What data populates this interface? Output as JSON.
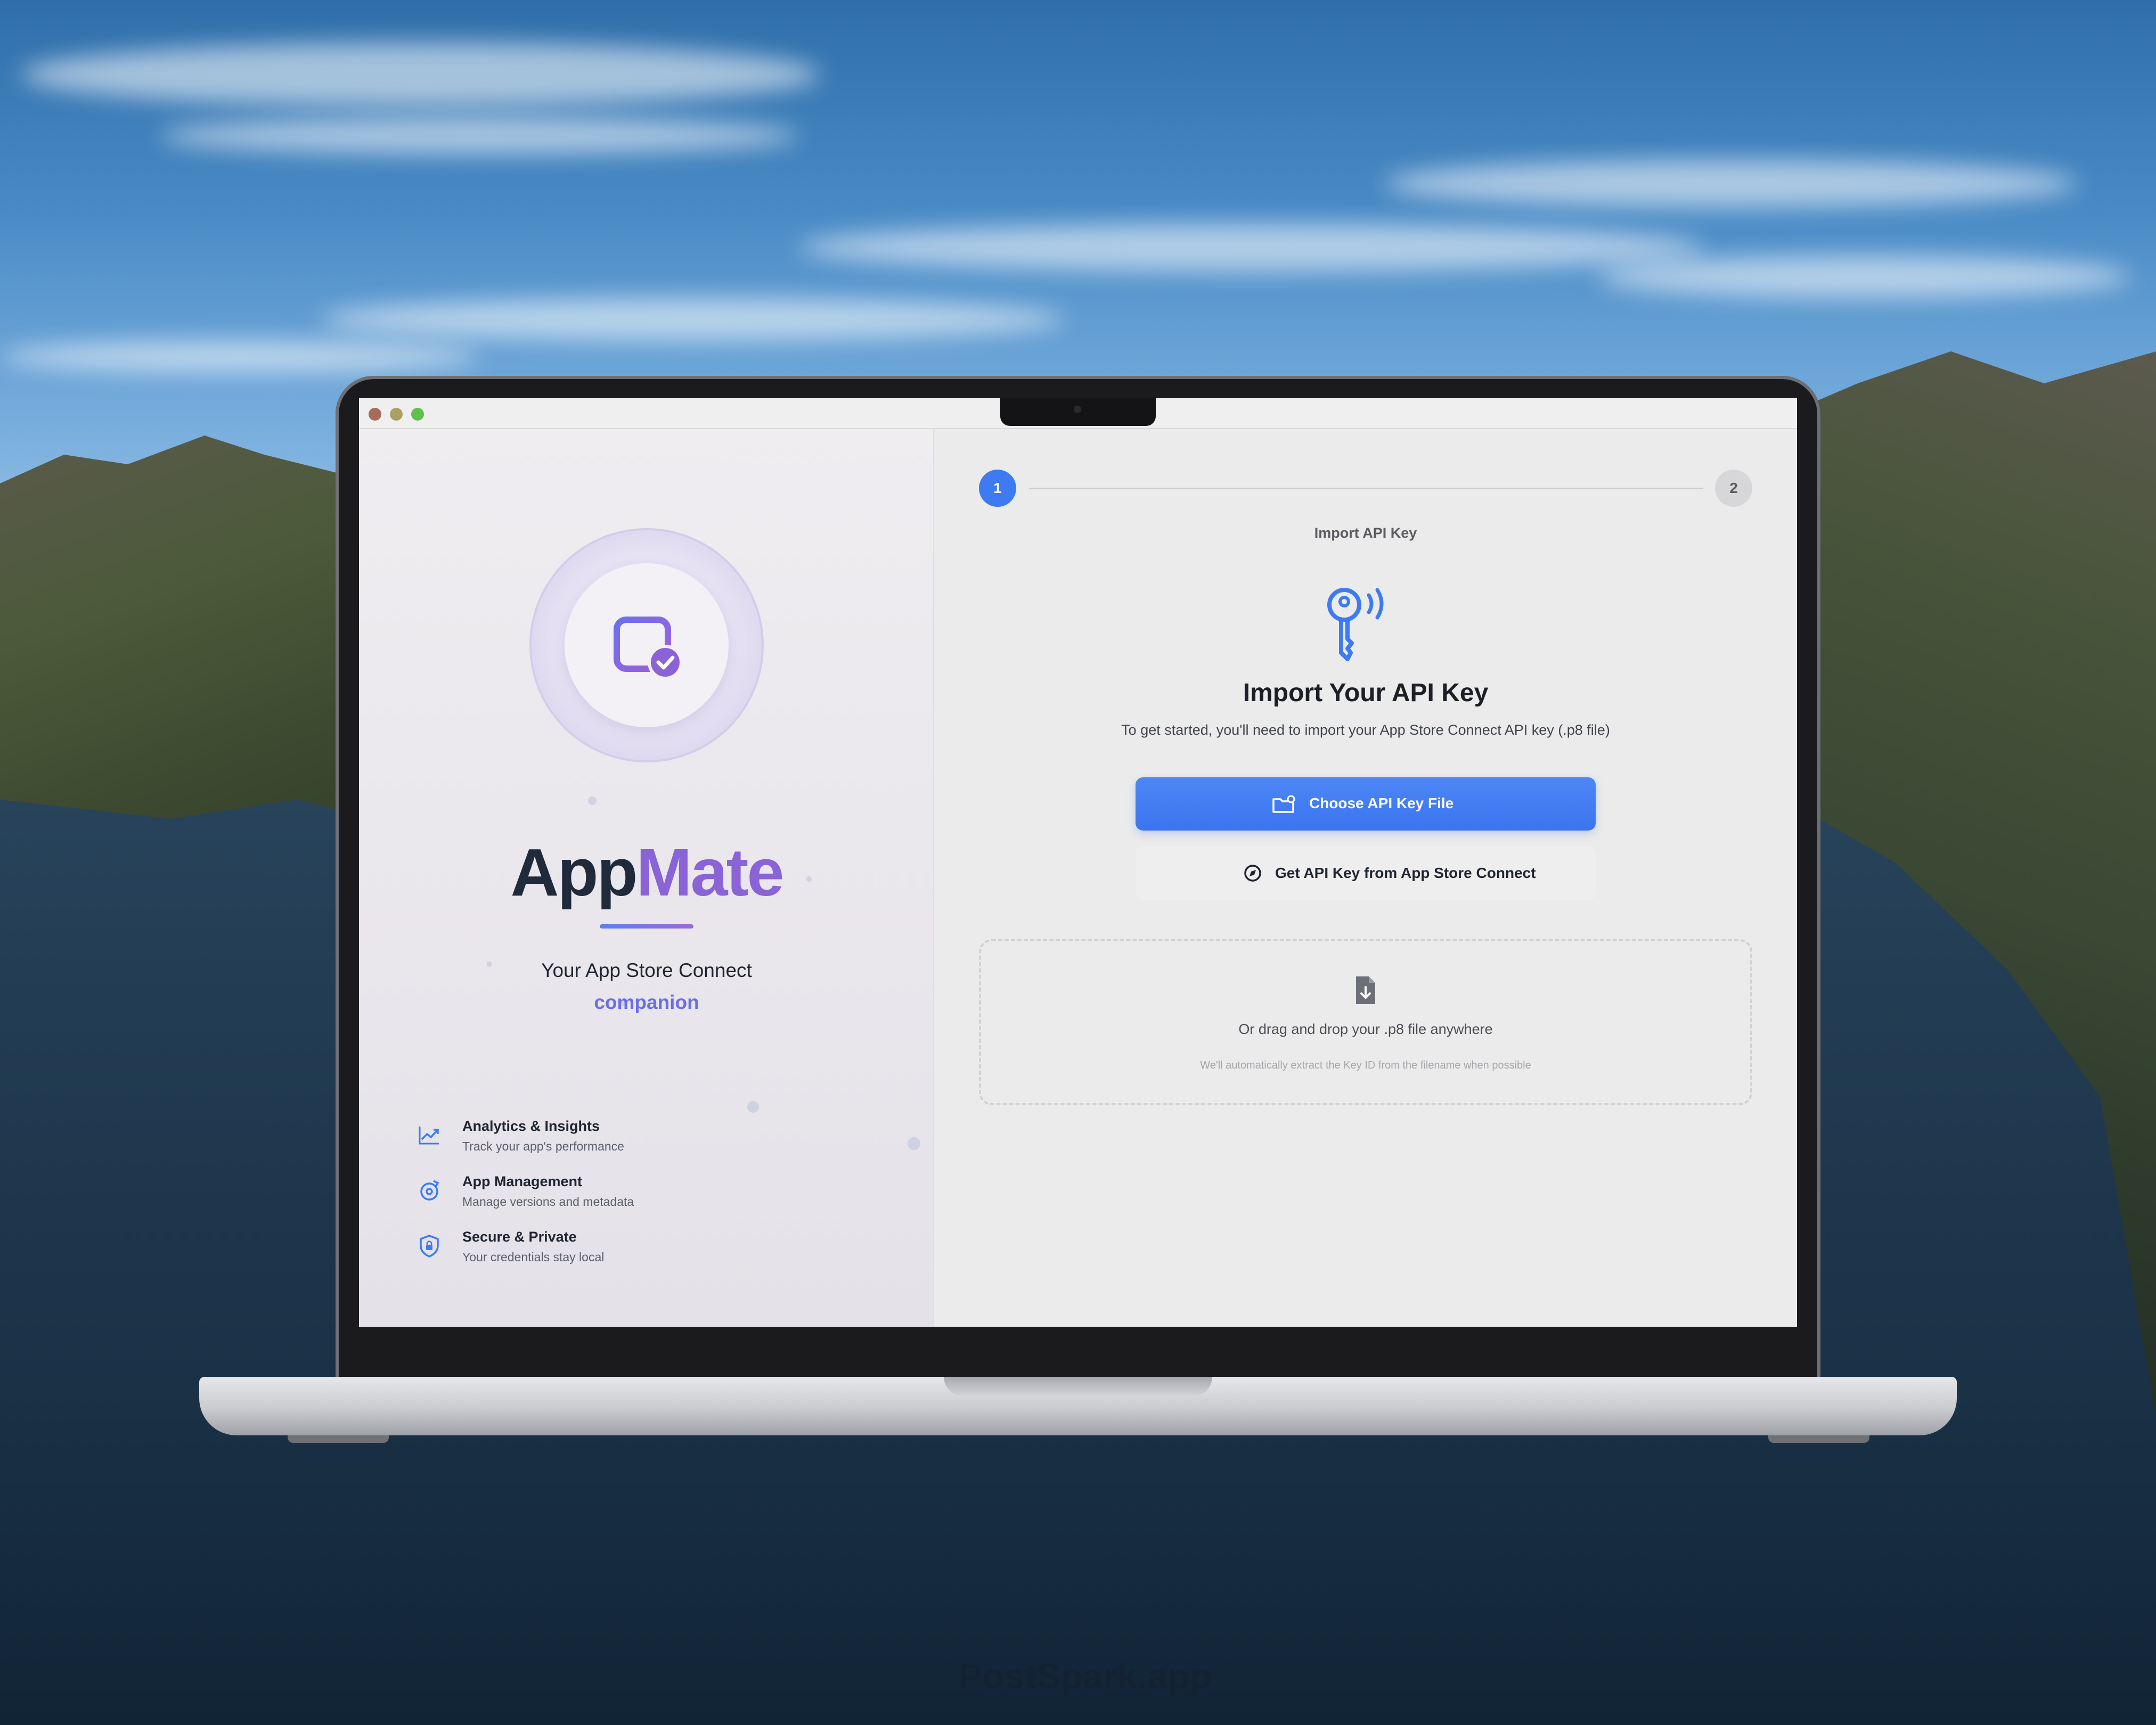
{
  "watermark": "PostSpark.app",
  "window": {
    "traffic_lights": {
      "close": "#ee6a5f",
      "minimize": "#f5bd4f",
      "zoom": "#61c554"
    }
  },
  "left_panel": {
    "logo_icon": "app-window-check-icon",
    "brand_part_1": "App",
    "brand_part_2": "Mate",
    "tagline": "Your App Store Connect",
    "tagline_highlight": "companion",
    "features": [
      {
        "icon": "chart-line-icon",
        "title": "Analytics & Insights",
        "subtitle": "Track your app's performance"
      },
      {
        "icon": "gear-sync-icon",
        "title": "App Management",
        "subtitle": "Manage versions and metadata"
      },
      {
        "icon": "shield-lock-icon",
        "title": "Secure & Private",
        "subtitle": "Your credentials stay local"
      }
    ]
  },
  "right_panel": {
    "steps": [
      {
        "number": "1",
        "state": "active"
      },
      {
        "number": "2",
        "state": "inactive"
      }
    ],
    "step_label": "Import API Key",
    "hero_icon": "key-signal-icon",
    "heading": "Import Your API Key",
    "description": "To get started, you'll need to import your App Store Connect API key (.p8 file)",
    "primary_button": {
      "icon": "folder-badge-icon",
      "label": "Choose API Key File"
    },
    "secondary_button": {
      "icon": "compass-icon",
      "label": "Get API Key from App Store Connect"
    },
    "dropzone": {
      "icon": "document-download-icon",
      "text": "Or drag and drop your .p8 file anywhere",
      "hint": "We'll automatically extract the Key ID from the filename when possible"
    }
  },
  "colors": {
    "accent_blue": "#3e7bf3",
    "brand_purple": "#8a63d6",
    "brand_dark": "#1f2a3a"
  }
}
